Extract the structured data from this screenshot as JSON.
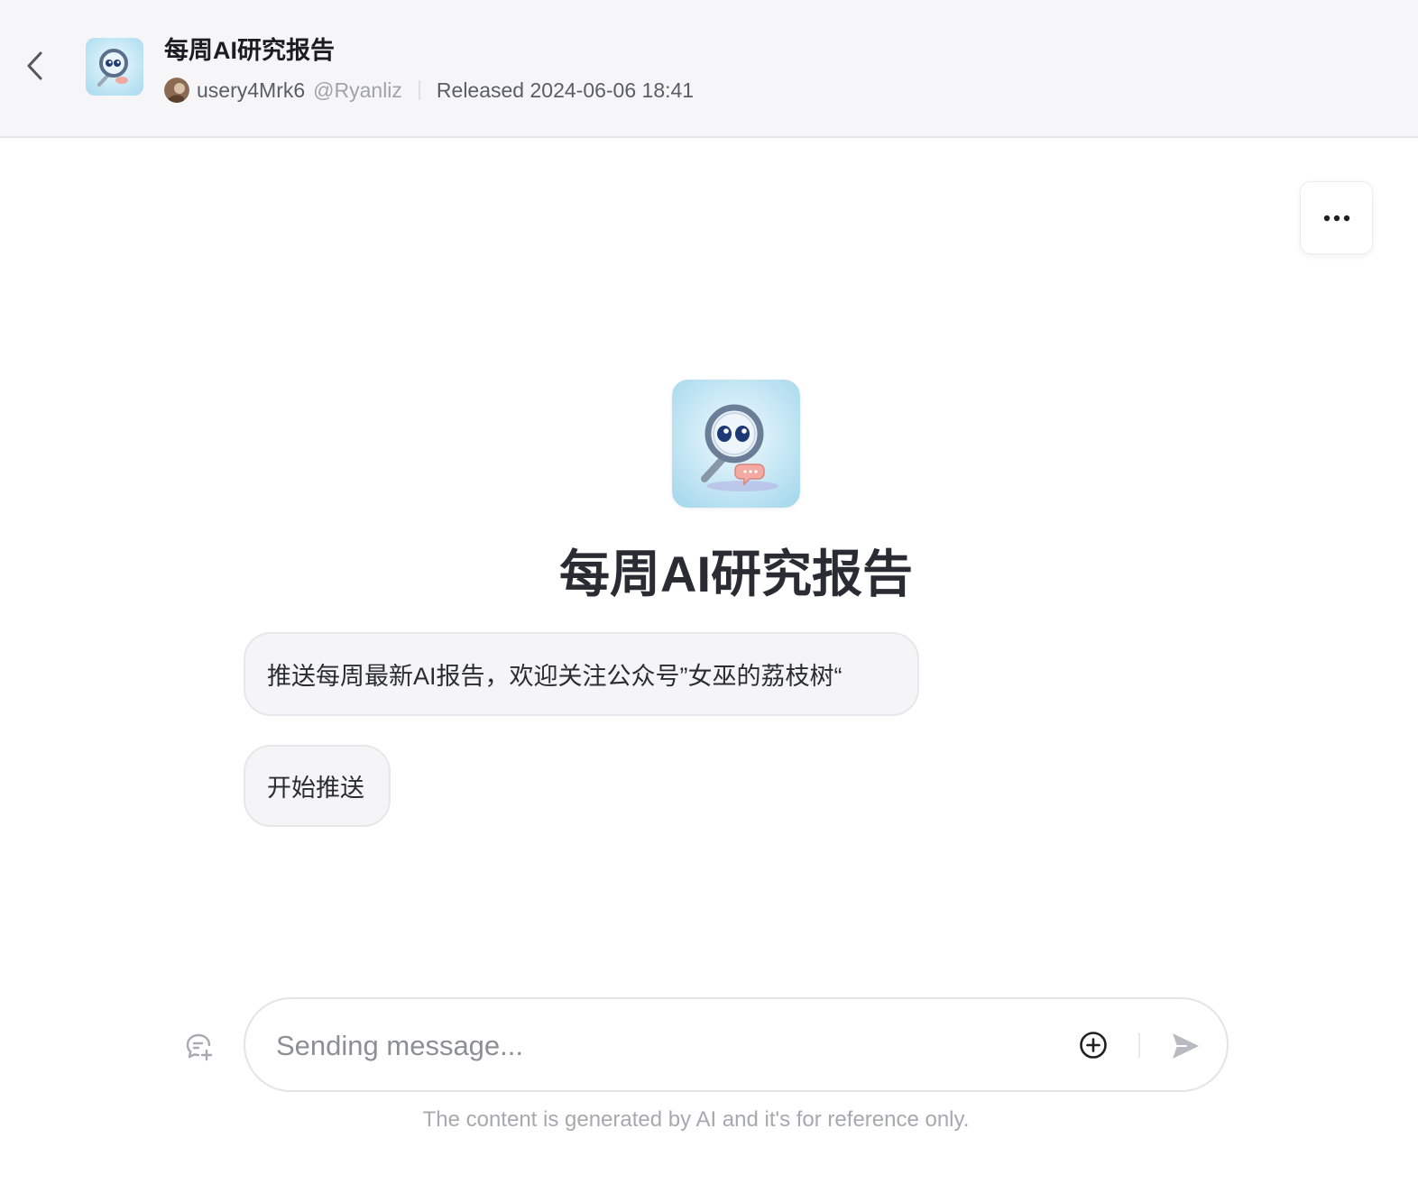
{
  "header": {
    "title": "每周AI研究报告",
    "author_name": "usery4Mrk6",
    "author_handle": "@Ryanliz",
    "released": "Released 2024-06-06 18:41"
  },
  "bot": {
    "name": "每周AI研究报告",
    "description": "推送每周最新AI报告，欢迎关注公众号”女巫的荔枝树“",
    "suggestion": "开始推送"
  },
  "composer": {
    "placeholder": "Sending message..."
  },
  "disclaimer": "The content is generated by AI and it's for reference only.",
  "icons": {
    "back": "chevron-left-icon",
    "more": "ellipsis-icon",
    "new_chat": "new-chat-icon",
    "attach": "plus-circle-icon",
    "send": "send-icon"
  },
  "colors": {
    "header_bg": "#f6f6f8",
    "bubble_bg": "#f5f5f7",
    "text_primary": "#1f1f24",
    "text_muted": "#a8a8b0"
  }
}
